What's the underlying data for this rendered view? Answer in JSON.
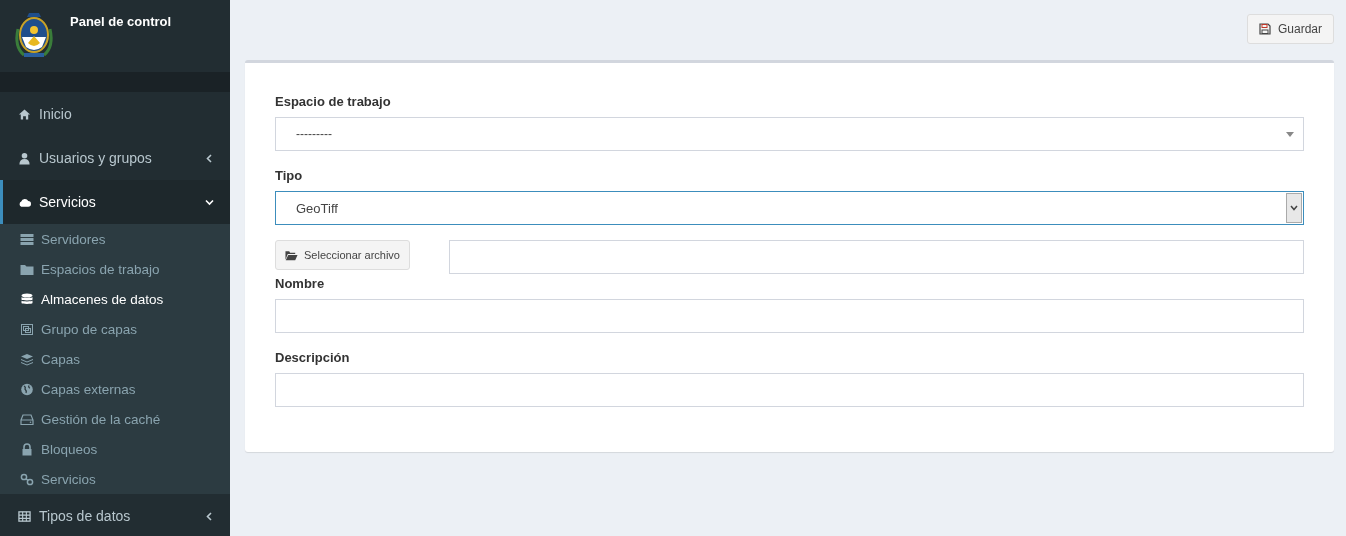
{
  "sidebar": {
    "title": "Panel de control",
    "menu": [
      {
        "label": "Inicio",
        "kind": "link",
        "selected": false
      },
      {
        "label": "Usuarios y grupos",
        "kind": "tree",
        "expanded": false,
        "selected": false
      },
      {
        "label": "Servicios",
        "kind": "tree",
        "expanded": true,
        "selected": true,
        "children": [
          {
            "label": "Servidores",
            "selected": false
          },
          {
            "label": "Espacios de trabajo",
            "selected": false
          },
          {
            "label": "Almacenes de datos",
            "selected": true
          },
          {
            "label": "Grupo de capas",
            "selected": false
          },
          {
            "label": "Capas",
            "selected": false
          },
          {
            "label": "Capas externas",
            "selected": false
          },
          {
            "label": "Gestión de la caché",
            "selected": false
          },
          {
            "label": "Bloqueos",
            "selected": false
          },
          {
            "label": "Servicios",
            "selected": false
          }
        ]
      },
      {
        "label": "Tipos de datos",
        "kind": "tree",
        "expanded": false,
        "selected": false
      }
    ]
  },
  "toolbar": {
    "save_button": "Guardar"
  },
  "form": {
    "fields": [
      {
        "kind": "select2",
        "label": "Espacio de trabajo",
        "value": "---------"
      },
      {
        "kind": "select",
        "label": "Tipo",
        "value": "GeoTiff",
        "focused": true
      },
      {
        "kind": "file",
        "button": "Seleccionar archivo"
      },
      {
        "kind": "text",
        "label": "Nombre"
      },
      {
        "kind": "text",
        "label": "Descripción"
      }
    ]
  }
}
